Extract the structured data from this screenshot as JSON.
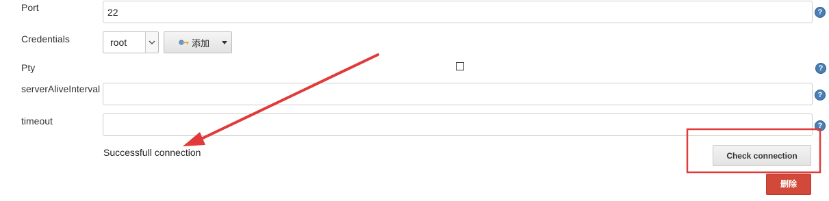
{
  "form": {
    "port": {
      "label": "Port",
      "value": "22"
    },
    "credentials": {
      "label": "Credentials",
      "selected": "root",
      "add_label": "添加"
    },
    "pty": {
      "label": "Pty"
    },
    "server_alive_interval": {
      "label": "serverAliveInterval",
      "value": ""
    },
    "timeout": {
      "label": "timeout",
      "value": ""
    },
    "help_glyph": "?"
  },
  "status": {
    "message": "Successfull connection"
  },
  "actions": {
    "check_connection": "Check connection",
    "delete": "删除"
  },
  "annotation": {
    "color": "#e03a3a"
  },
  "icons": [
    "help-icon",
    "chevron-down-icon",
    "key-icon",
    "caret-down-icon"
  ]
}
